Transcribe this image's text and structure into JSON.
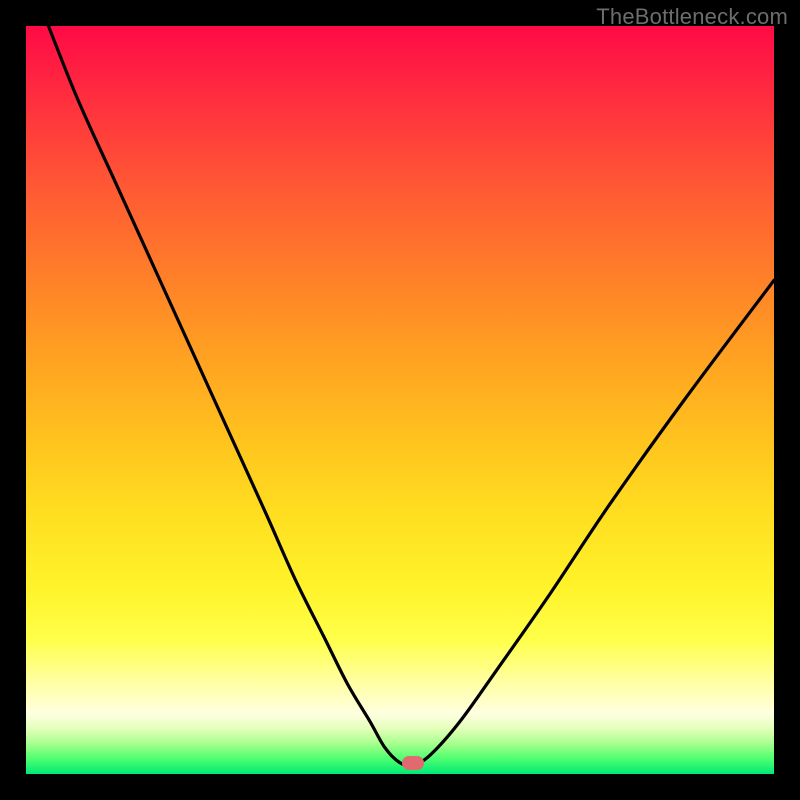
{
  "watermark": "TheBottleneck.com",
  "dot": {
    "x_frac": 0.517,
    "y_frac": 0.985
  },
  "colors": {
    "frame_bg": "#000000",
    "watermark": "#6d6d6d",
    "curve": "#000000",
    "dot": "#e06a6f"
  },
  "chart_data": {
    "type": "line",
    "title": "",
    "xlabel": "",
    "ylabel": "",
    "xlim": [
      0,
      100
    ],
    "ylim": [
      0,
      100
    ],
    "grid": false,
    "legend": false,
    "series": [
      {
        "name": "bottleneck-curve",
        "x": [
          3,
          7,
          12,
          17,
          22,
          27,
          32,
          36,
          40,
          43,
          46,
          48,
          50,
          51.7,
          54,
          58,
          63,
          70,
          78,
          88,
          100
        ],
        "y": [
          100,
          90,
          79,
          68,
          57,
          46,
          35,
          26,
          18,
          12,
          7,
          3.5,
          1.5,
          1.2,
          2.5,
          7,
          14,
          24,
          36,
          50,
          66
        ]
      }
    ],
    "marker": {
      "x": 51.7,
      "y": 1.2
    }
  }
}
